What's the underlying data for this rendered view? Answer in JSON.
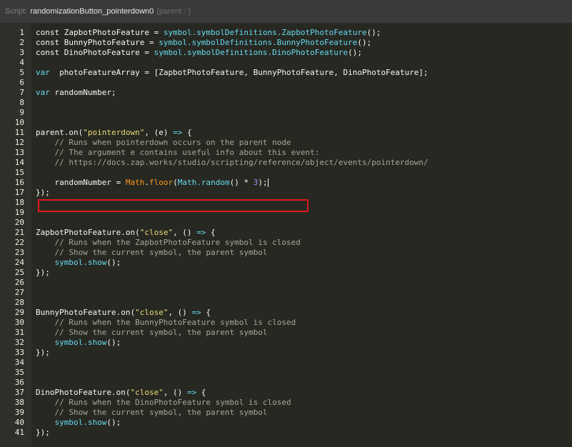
{
  "title_bar": {
    "script_label": "Script:",
    "script_name": "randomizationButton_pointerdown0",
    "parent_info": "(parent : )"
  },
  "editor": {
    "highlighted_line": 16,
    "colors": {
      "background": "#272822",
      "gutter": "#2f2f2a",
      "highlight_box": "#e0191f",
      "string": "#e6db74",
      "property": "#66d9ef",
      "comment": "#a7a79a",
      "builtin": "#fd971f",
      "number": "#ae81ff"
    },
    "lines": [
      {
        "n": "1",
        "tokens": [
          [
            "kw",
            "const "
          ],
          [
            "plain",
            "ZapbotPhotoFeature = "
          ],
          [
            "prop",
            "symbol.symbolDefinitions.ZapbotPhotoFeature"
          ],
          [
            "plain",
            "();"
          ]
        ]
      },
      {
        "n": "2",
        "tokens": [
          [
            "kw",
            "const "
          ],
          [
            "plain",
            "BunnyPhotoFeature = "
          ],
          [
            "prop",
            "symbol.symbolDefinitions.BunnyPhotoFeature"
          ],
          [
            "plain",
            "();"
          ]
        ]
      },
      {
        "n": "3",
        "tokens": [
          [
            "kw",
            "const "
          ],
          [
            "plain",
            "DinoPhotoFeature = "
          ],
          [
            "prop",
            "symbol.symbolDefinitions.DinoPhotoFeature"
          ],
          [
            "plain",
            "();"
          ]
        ]
      },
      {
        "n": "4",
        "tokens": []
      },
      {
        "n": "5",
        "tokens": [
          [
            "prop",
            "var"
          ],
          [
            "plain",
            "  photoFeatureArray = [ZapbotPhotoFeature, BunnyPhotoFeature, DinoPhotoFeature];"
          ]
        ]
      },
      {
        "n": "6",
        "tokens": []
      },
      {
        "n": "7",
        "tokens": [
          [
            "prop",
            "var"
          ],
          [
            "plain",
            " randomNumber;"
          ]
        ]
      },
      {
        "n": "8",
        "tokens": []
      },
      {
        "n": "9",
        "tokens": []
      },
      {
        "n": "10",
        "tokens": []
      },
      {
        "n": "11",
        "tokens": [
          [
            "plain",
            "parent.on("
          ],
          [
            "str",
            "\"pointerdown\""
          ],
          [
            "plain",
            ", (e) "
          ],
          [
            "prop",
            "=>"
          ],
          [
            "plain",
            " {"
          ]
        ]
      },
      {
        "n": "12",
        "tokens": [
          [
            "comment",
            "    // Runs when pointerdown occurs on the parent node"
          ]
        ]
      },
      {
        "n": "13",
        "tokens": [
          [
            "comment",
            "    // The argument e contains useful info about this event:"
          ]
        ]
      },
      {
        "n": "14",
        "tokens": [
          [
            "comment",
            "    // https://docs.zap.works/studio/scripting/reference/object/events/pointerdown/"
          ]
        ]
      },
      {
        "n": "15",
        "tokens": []
      },
      {
        "n": "16",
        "tokens": [
          [
            "plain",
            "    randomNumber = "
          ],
          [
            "builtin",
            "Math"
          ],
          [
            "plain",
            "."
          ],
          [
            "builtin",
            "floor"
          ],
          [
            "plain",
            "("
          ],
          [
            "prop",
            "Math.random"
          ],
          [
            "plain",
            "() * "
          ],
          [
            "num",
            "3"
          ],
          [
            "plain",
            ");"
          ]
        ],
        "cursor": true
      },
      {
        "n": "17",
        "tokens": [
          [
            "plain",
            "});"
          ]
        ]
      },
      {
        "n": "18",
        "tokens": []
      },
      {
        "n": "19",
        "tokens": []
      },
      {
        "n": "20",
        "tokens": []
      },
      {
        "n": "21",
        "tokens": [
          [
            "plain",
            "ZapbotPhotoFeature.on("
          ],
          [
            "str",
            "\"close\""
          ],
          [
            "plain",
            ", () "
          ],
          [
            "prop",
            "=>"
          ],
          [
            "plain",
            " {"
          ]
        ]
      },
      {
        "n": "22",
        "tokens": [
          [
            "comment",
            "    // Runs when the ZapbotPhotoFeature symbol is closed"
          ]
        ]
      },
      {
        "n": "23",
        "tokens": [
          [
            "comment",
            "    // Show the current symbol, the parent symbol"
          ]
        ]
      },
      {
        "n": "24",
        "tokens": [
          [
            "plain",
            "    "
          ],
          [
            "prop",
            "symbol.show"
          ],
          [
            "plain",
            "();"
          ]
        ]
      },
      {
        "n": "25",
        "tokens": [
          [
            "plain",
            "});"
          ]
        ]
      },
      {
        "n": "26",
        "tokens": []
      },
      {
        "n": "27",
        "tokens": []
      },
      {
        "n": "28",
        "tokens": []
      },
      {
        "n": "29",
        "tokens": [
          [
            "plain",
            "BunnyPhotoFeature.on("
          ],
          [
            "str",
            "\"close\""
          ],
          [
            "plain",
            ", () "
          ],
          [
            "prop",
            "=>"
          ],
          [
            "plain",
            " {"
          ]
        ]
      },
      {
        "n": "30",
        "tokens": [
          [
            "comment",
            "    // Runs when the BunnyPhotoFeature symbol is closed"
          ]
        ]
      },
      {
        "n": "31",
        "tokens": [
          [
            "comment",
            "    // Show the current symbol, the parent symbol"
          ]
        ]
      },
      {
        "n": "32",
        "tokens": [
          [
            "plain",
            "    "
          ],
          [
            "prop",
            "symbol.show"
          ],
          [
            "plain",
            "();"
          ]
        ]
      },
      {
        "n": "33",
        "tokens": [
          [
            "plain",
            "});"
          ]
        ]
      },
      {
        "n": "34",
        "tokens": []
      },
      {
        "n": "35",
        "tokens": []
      },
      {
        "n": "36",
        "tokens": []
      },
      {
        "n": "37",
        "tokens": [
          [
            "plain",
            "DinoPhotoFeature.on("
          ],
          [
            "str",
            "\"close\""
          ],
          [
            "plain",
            ", () "
          ],
          [
            "prop",
            "=>"
          ],
          [
            "plain",
            " {"
          ]
        ]
      },
      {
        "n": "38",
        "tokens": [
          [
            "comment",
            "    // Runs when the DinoPhotoFeature symbol is closed"
          ]
        ]
      },
      {
        "n": "39",
        "tokens": [
          [
            "comment",
            "    // Show the current symbol, the parent symbol"
          ]
        ]
      },
      {
        "n": "40",
        "tokens": [
          [
            "plain",
            "    "
          ],
          [
            "prop",
            "symbol.show"
          ],
          [
            "plain",
            "();"
          ]
        ]
      },
      {
        "n": "41",
        "tokens": [
          [
            "plain",
            "});"
          ]
        ]
      }
    ]
  }
}
